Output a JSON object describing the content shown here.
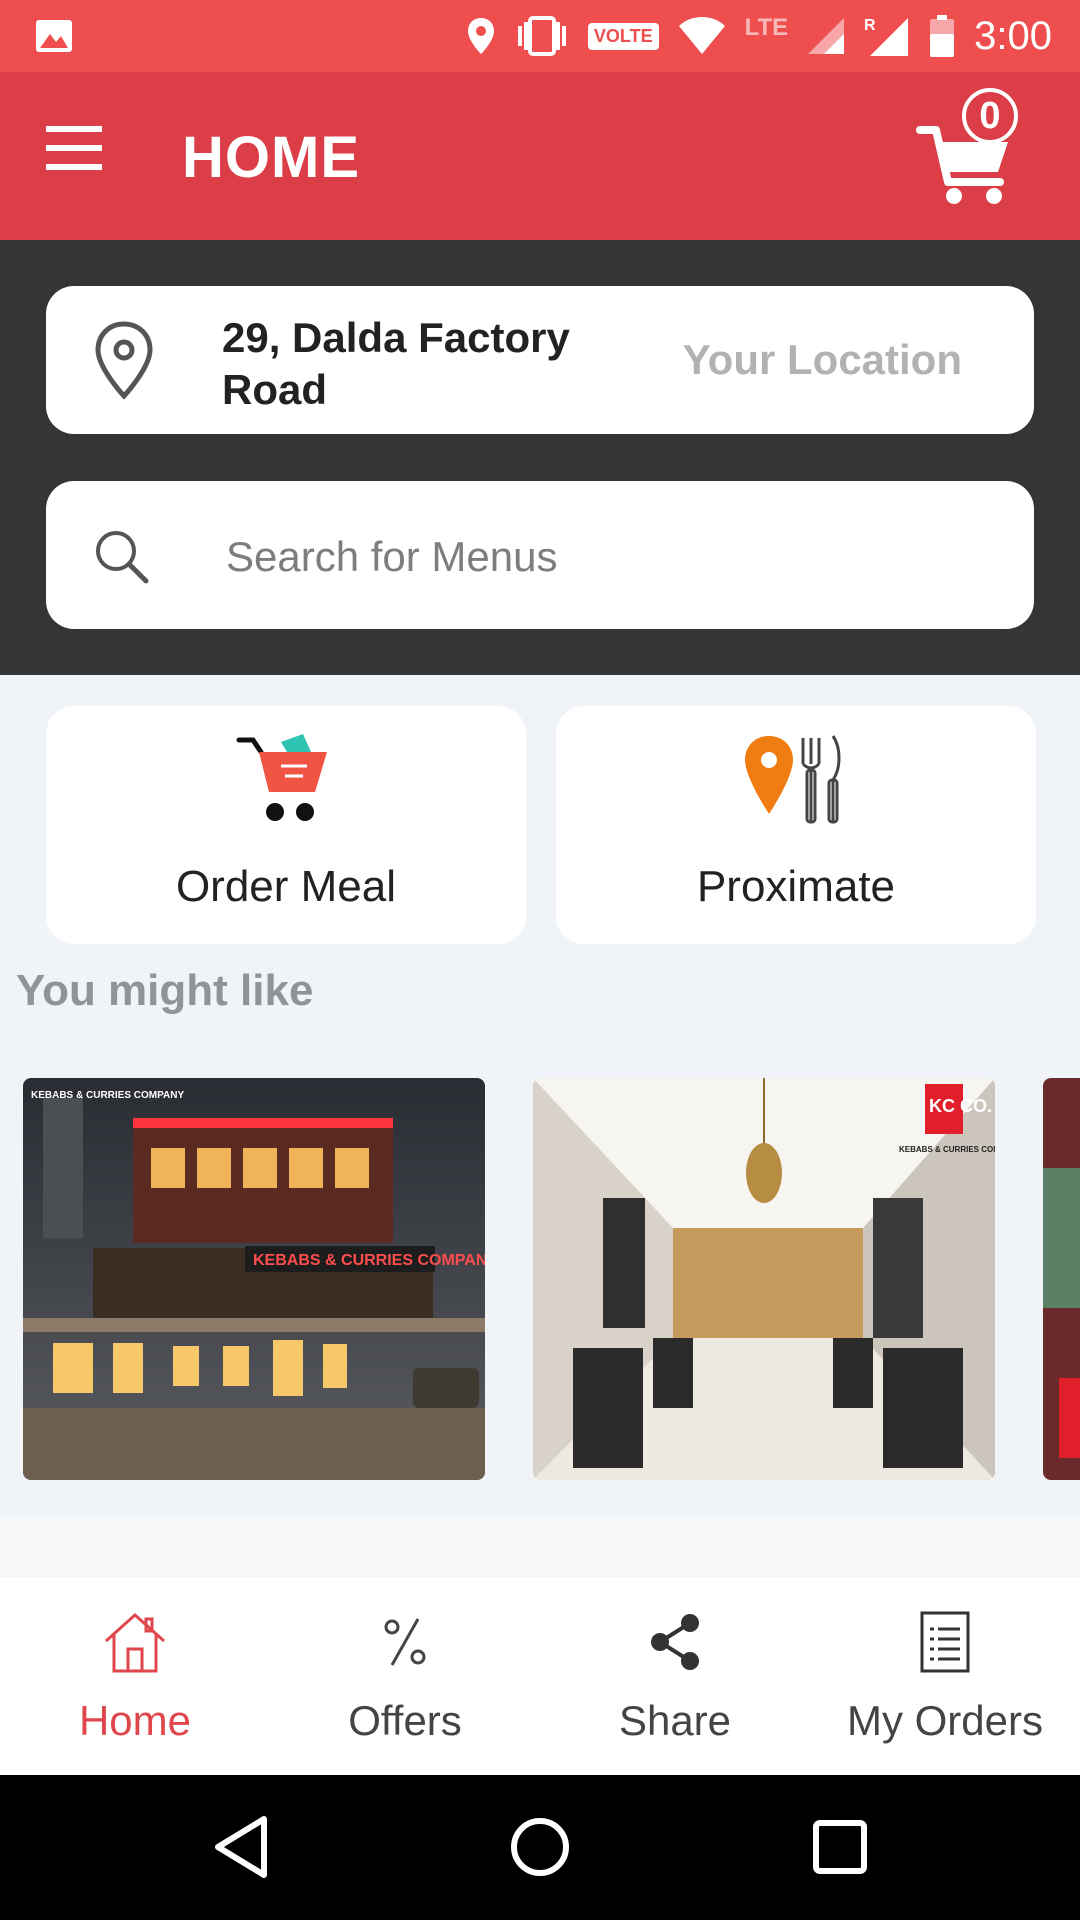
{
  "status_bar": {
    "time": "3:00",
    "volte": "VOLTE",
    "lte": "LTE",
    "roaming": "R",
    "icons": [
      "image-icon",
      "location-icon",
      "vibrate-icon",
      "wifi-icon",
      "signal-icon",
      "battery-icon"
    ]
  },
  "app_bar": {
    "title": "HOME",
    "cart_count": "0"
  },
  "location": {
    "address": "29, Dalda Factory Road",
    "label": "Your Location"
  },
  "search": {
    "placeholder": "Search for Menus"
  },
  "tiles": [
    {
      "label": "Order Meal",
      "icon": "shopping-cart-icon"
    },
    {
      "label": "Proximate",
      "icon": "location-cutlery-icon"
    }
  ],
  "section_title": "You might like",
  "carousel": {
    "cards": [
      {
        "sign_text": "KEBABS & CURRIES COMPANY",
        "logo_text": "KEBABS & CURRIES COMPANY"
      },
      {
        "logo_text": "KC CO.",
        "logo_subtext": "KEBABS & CURRIES COMPANY"
      },
      {
        "logo_text": ""
      }
    ]
  },
  "bottom_nav": {
    "items": [
      {
        "label": "Home",
        "icon": "home-icon",
        "active": true
      },
      {
        "label": "Offers",
        "icon": "percent-icon",
        "active": false
      },
      {
        "label": "Share",
        "icon": "share-icon",
        "active": false
      },
      {
        "label": "My Orders",
        "icon": "orders-list-icon",
        "active": false
      }
    ]
  },
  "colors": {
    "status_bar": "#ef4e4e",
    "app_bar": "#dc3e47",
    "dark_area": "#343536",
    "accent": "#e0474c",
    "proximate_pin": "#ef7d12"
  }
}
